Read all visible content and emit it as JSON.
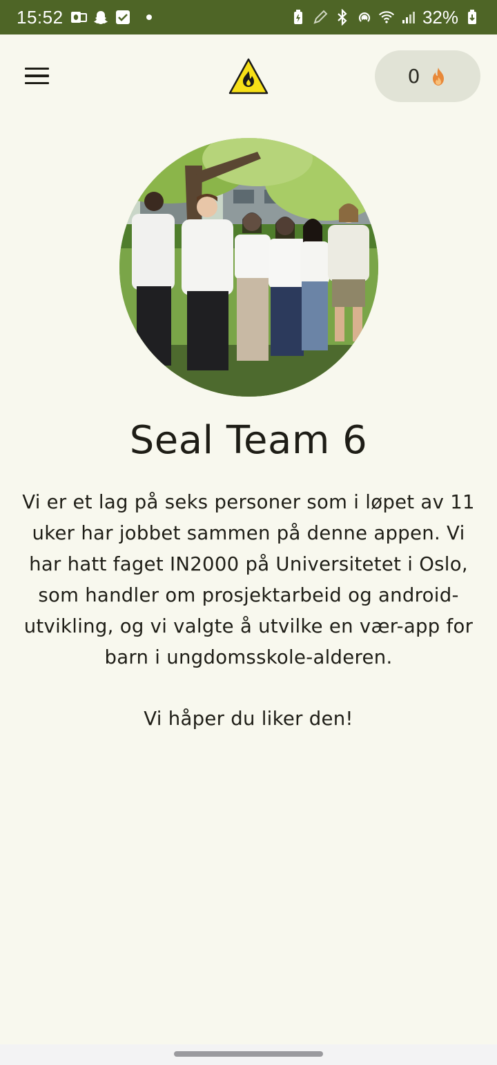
{
  "status_bar": {
    "time": "15:52",
    "battery": "32%",
    "left_icons": [
      "outlook-icon",
      "snapchat-icon",
      "checkbox-icon",
      "notification-dot"
    ],
    "right_icons": [
      "battery-saver-icon",
      "pen-icon",
      "bluetooth-icon",
      "hotspot-icon",
      "wifi-icon",
      "signal-icon",
      "battery-charging-icon"
    ],
    "background": "#4e6526"
  },
  "app_bar": {
    "menu_icon": "hamburger-menu-icon",
    "logo_icon": "fire-warning-logo",
    "streak_count": "0",
    "streak_icon": "flame-icon"
  },
  "about": {
    "photo": "team-group-photo",
    "title": "Seal Team 6",
    "description": "Vi er et lag på seks personer som i løpet av 11 uker har jobbet sammen på denne appen. Vi har hatt faget IN2000 på Universitetet i Oslo, som handler om prosjektarbeid og android-utvikling, og vi valgte å utvilke en vær-app for barn i ungdomsskole-alderen.",
    "closing": "Vi håper du liker den!"
  },
  "colors": {
    "background": "#f8f8ee",
    "pill": "#e1e3d6",
    "flame": "#e8893a",
    "logo_yellow": "#f7e017"
  }
}
